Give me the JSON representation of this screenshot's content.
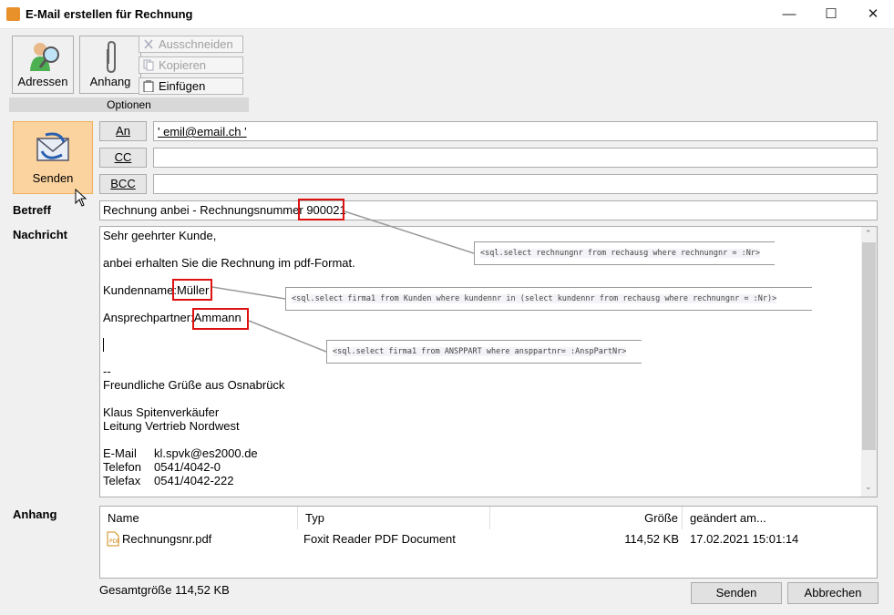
{
  "window": {
    "title": "E-Mail erstellen für Rechnung",
    "minimize": "—",
    "maximize": "☐",
    "close": "✕"
  },
  "ribbon": {
    "addresses_label": "Adressen",
    "attachment_label": "Anhang",
    "cut_label": "Ausschneiden",
    "copy_label": "Kopieren",
    "paste_label": "Einfügen",
    "group_label": "Optionen"
  },
  "form": {
    "send_label": "Senden",
    "to_button": "An",
    "cc_button": "CC",
    "bcc_button": "BCC",
    "to_value": "' emil@email.ch '",
    "cc_value": "",
    "bcc_value": "",
    "subject_label": "Betreff",
    "subject_prefix": "Rechnung anbei - Rechnungsnummer ",
    "subject_number": "900021",
    "message_label": "Nachricht",
    "attachment_label": "Anhang"
  },
  "message": {
    "greeting": "Sehr geehrter Kunde,",
    "intro": "anbei erhalten Sie die Rechnung im pdf-Format.",
    "customer_label": "Kundenname:",
    "customer_value": "Müller",
    "contact_label": "Ansprechpartner:",
    "contact_value": "Ammann",
    "sig_dash": "--",
    "sig_greeting": "Freundliche Grüße aus Osnabrück",
    "sig_name": "Klaus Spitenverkäufer",
    "sig_title": "Leitung Vertrieb Nordwest",
    "email_label": "E-Mail",
    "email_value": "kl.spvk@es2000.de",
    "phone_label": "Telefon",
    "phone_value": "0541/4042-0",
    "fax_label": "Telefax",
    "fax_value": "0541/4042-222"
  },
  "annotations": {
    "sql1": "<sql.select rechnungnr from rechausg where rechnungnr = :Nr>",
    "sql2": "<sql.select firma1 from Kunden where kundennr in (select kundennr from rechausg where rechnungnr = :Nr)>",
    "sql3": "<sql.select firma1 from ANSPPART where ansppartnr= :AnspPartNr>"
  },
  "attachments": {
    "columns": [
      "Name",
      "Typ",
      "Größe",
      "geändert am..."
    ],
    "rows": [
      {
        "name": "Rechnungsnr.pdf",
        "type": "Foxit Reader PDF Document",
        "size": "114,52 KB",
        "modified": "17.02.2021 15:01:14"
      }
    ],
    "total": "Gesamtgröße 114,52 KB"
  },
  "footer": {
    "send_button": "Senden",
    "cancel_button": "Abbrechen"
  },
  "colors": {
    "accent_send": "#fbd39e",
    "highlight_box": "#dd1111"
  }
}
